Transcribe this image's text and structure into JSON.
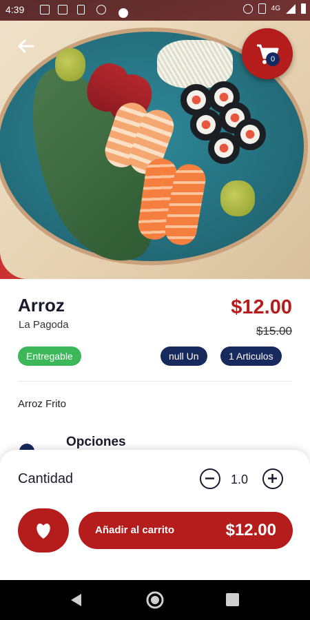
{
  "status_bar": {
    "time": "4:39",
    "network": "4G"
  },
  "product": {
    "name": "Arroz",
    "store": "La Pagoda",
    "price": "$12.00",
    "old_price": "$15.00",
    "deliverable_badge": "Entregable",
    "unit_badge": "null Un",
    "items_badge": "1 Articulos",
    "description": "Arroz Frito",
    "options_title": "Opciones"
  },
  "cart": {
    "count": "0"
  },
  "quantity": {
    "label": "Cantidad",
    "value": "1.0"
  },
  "actions": {
    "add_to_cart_label": "Añadir al carrito",
    "add_to_cart_amount": "$12.00"
  },
  "colors": {
    "brand_red": "#b51d1d",
    "navy": "#17295d",
    "green": "#3cb75a"
  },
  "icons": [
    "back-arrow-icon",
    "cart-icon",
    "heart-icon",
    "minus-circle-icon",
    "plus-circle-icon",
    "nav-back-icon",
    "nav-home-icon",
    "nav-recents-icon"
  ]
}
